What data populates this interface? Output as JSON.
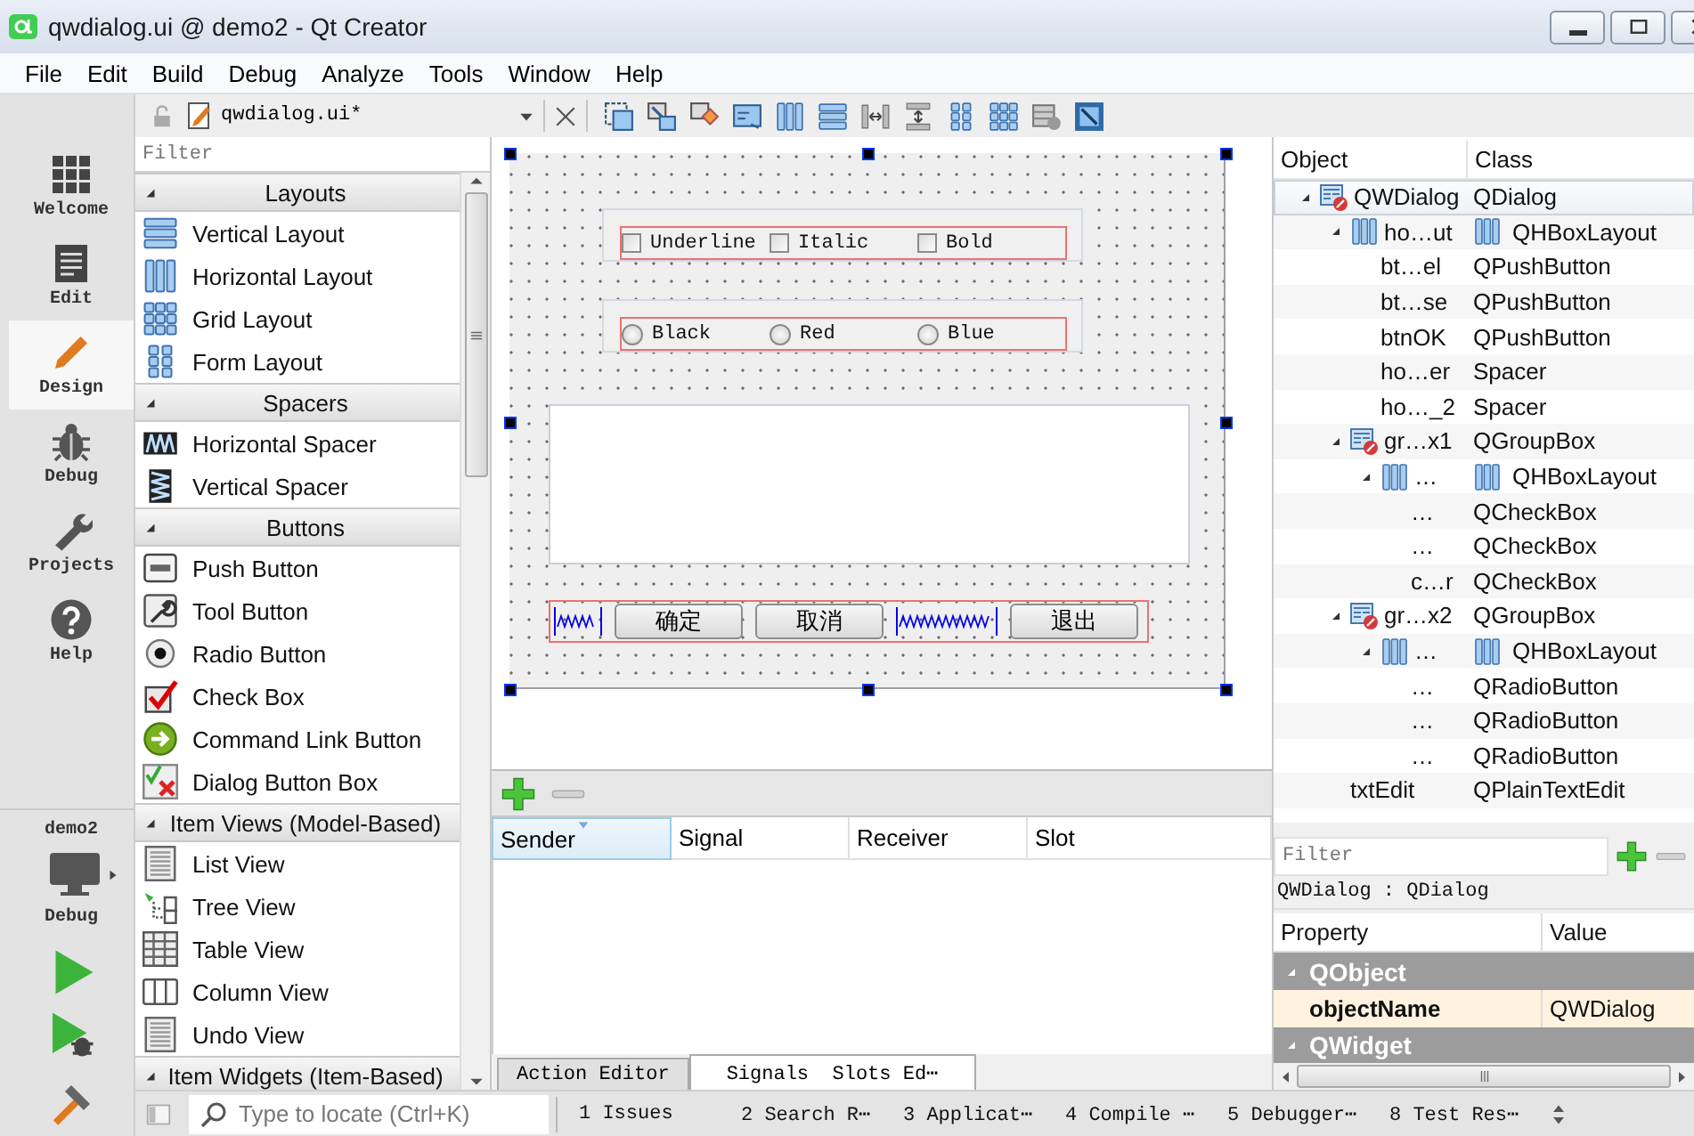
{
  "window": {
    "title": "qwdialog.ui @ demo2 - Qt Creator"
  },
  "menu": [
    "File",
    "Edit",
    "Build",
    "Debug",
    "Analyze",
    "Tools",
    "Window",
    "Help"
  ],
  "editor_toolbar": {
    "document": "qwdialog.ui*"
  },
  "modes": [
    {
      "label": "Welcome",
      "kind": "welcome",
      "selected": false
    },
    {
      "label": "Edit",
      "kind": "edit",
      "selected": false
    },
    {
      "label": "Design",
      "kind": "design",
      "selected": true
    },
    {
      "label": "Debug",
      "kind": "debug",
      "selected": false
    },
    {
      "label": "Projects",
      "kind": "projects",
      "selected": false
    },
    {
      "label": "Help",
      "kind": "help",
      "selected": false
    }
  ],
  "target": {
    "project": "demo2",
    "build": "Debug"
  },
  "widget_box": {
    "filter_placeholder": "Filter",
    "categories": [
      {
        "title": "Layouts",
        "expanded": true,
        "items": [
          {
            "label": "Vertical Layout",
            "kind": "vlayout"
          },
          {
            "label": "Horizontal Layout",
            "kind": "hlayout"
          },
          {
            "label": "Grid Layout",
            "kind": "grid"
          },
          {
            "label": "Form Layout",
            "kind": "form"
          }
        ]
      },
      {
        "title": "Spacers",
        "expanded": true,
        "items": [
          {
            "label": "Horizontal Spacer",
            "kind": "hspacer"
          },
          {
            "label": "Vertical Spacer",
            "kind": "vspacer"
          }
        ]
      },
      {
        "title": "Buttons",
        "expanded": true,
        "items": [
          {
            "label": "Push Button",
            "kind": "push"
          },
          {
            "label": "Tool Button",
            "kind": "tool"
          },
          {
            "label": "Radio Button",
            "kind": "radio"
          },
          {
            "label": "Check Box",
            "kind": "check"
          },
          {
            "label": "Command Link Button",
            "kind": "cmdlink"
          },
          {
            "label": "Dialog Button Box",
            "kind": "dbb"
          }
        ]
      },
      {
        "title": "Item Views (Model-Based)",
        "expanded": true,
        "items": [
          {
            "label": "List View",
            "kind": "list"
          },
          {
            "label": "Tree View",
            "kind": "tree"
          },
          {
            "label": "Table View",
            "kind": "table"
          },
          {
            "label": "Column View",
            "kind": "column"
          },
          {
            "label": "Undo View",
            "kind": "list"
          }
        ]
      },
      {
        "title": "Item Widgets (Item-Based)",
        "expanded": true
      }
    ]
  },
  "form": {
    "checkboxes": [
      {
        "label": "Underline",
        "checked": false
      },
      {
        "label": "Italic",
        "checked": false
      },
      {
        "label": "Bold",
        "checked": false
      }
    ],
    "radios": [
      {
        "label": "Black",
        "selected": false
      },
      {
        "label": "Red",
        "selected": false
      },
      {
        "label": "Blue",
        "selected": false
      }
    ],
    "button_row": [
      {
        "kind": "spacer"
      },
      {
        "kind": "button",
        "label": "确定"
      },
      {
        "kind": "button",
        "label": "取消"
      },
      {
        "kind": "spacer"
      },
      {
        "kind": "button",
        "label": "退出"
      }
    ]
  },
  "signal_slot_editor": {
    "columns": [
      {
        "label": "Sender",
        "sorted": true
      },
      {
        "label": "Signal",
        "sorted": false
      },
      {
        "label": "Receiver",
        "sorted": false
      },
      {
        "label": "Slot",
        "sorted": false
      }
    ],
    "tabs": [
      {
        "label": "Action Editor",
        "selected": false
      },
      {
        "label": "Signals  Slots Ed⋯",
        "selected": true
      }
    ]
  },
  "object_inspector": {
    "columns": [
      "Object",
      "Class"
    ],
    "tree": [
      {
        "name": "QWDialog",
        "class": "QDialog",
        "kind": "dialog",
        "selected": true,
        "expanded": true,
        "children": [
          {
            "name": "ho…ut",
            "class": "QHBoxLayout",
            "kind": "layout",
            "selected": false,
            "expanded": true,
            "children": [
              {
                "name": "bt…el",
                "class": "QPushButton",
                "selected": false
              },
              {
                "name": "bt…se",
                "class": "QPushButton",
                "selected": false
              },
              {
                "name": "btnOK",
                "class": "QPushButton",
                "selected": false
              },
              {
                "name": "ho…er",
                "class": "Spacer",
                "selected": false
              },
              {
                "name": "ho…_2",
                "class": "Spacer",
                "selected": false
              }
            ]
          },
          {
            "name": "gr…x1",
            "class": "QGroupBox",
            "kind": "dialog",
            "selected": false,
            "expanded": true,
            "children": [
              {
                "name": "…",
                "class": "QHBoxLayout",
                "kind": "layout",
                "selected": false,
                "expanded": true,
                "children": [
                  {
                    "name": "…",
                    "class": "QCheckBox",
                    "selected": false
                  },
                  {
                    "name": "…",
                    "class": "QCheckBox",
                    "selected": false
                  },
                  {
                    "name": "c…r",
                    "class": "QCheckBox",
                    "selected": false
                  }
                ]
              }
            ]
          },
          {
            "name": "gr…x2",
            "class": "QGroupBox",
            "kind": "dialog",
            "selected": false,
            "expanded": true,
            "children": [
              {
                "name": "…",
                "class": "QHBoxLayout",
                "kind": "layout",
                "selected": false,
                "expanded": true,
                "children": [
                  {
                    "name": "…",
                    "class": "QRadioButton",
                    "selected": false
                  },
                  {
                    "name": "…",
                    "class": "QRadioButton",
                    "selected": false
                  },
                  {
                    "name": "…",
                    "class": "QRadioButton",
                    "selected": false
                  }
                ]
              }
            ]
          },
          {
            "name": "txtEdit",
            "class": "QPlainTextEdit",
            "selected": false
          }
        ]
      }
    ]
  },
  "property_editor": {
    "filter_placeholder": "Filter",
    "object_label": "QWDialog : QDialog",
    "columns": [
      "Property",
      "Value"
    ],
    "rows": [
      {
        "kind": "group",
        "label": "QObject",
        "expanded": true
      },
      {
        "kind": "property",
        "name": "objectName",
        "value": "QWDialog"
      },
      {
        "kind": "group",
        "label": "QWidget",
        "expanded": true
      }
    ]
  },
  "status_bar": {
    "locate_placeholder": "Type to locate (Ctrl+K)",
    "panes": [
      "1 Issues",
      "2 Search R⋯",
      "3 Applicat⋯",
      "4 Compile ⋯",
      "5 Debugger⋯",
      "8 Test Res⋯"
    ]
  }
}
